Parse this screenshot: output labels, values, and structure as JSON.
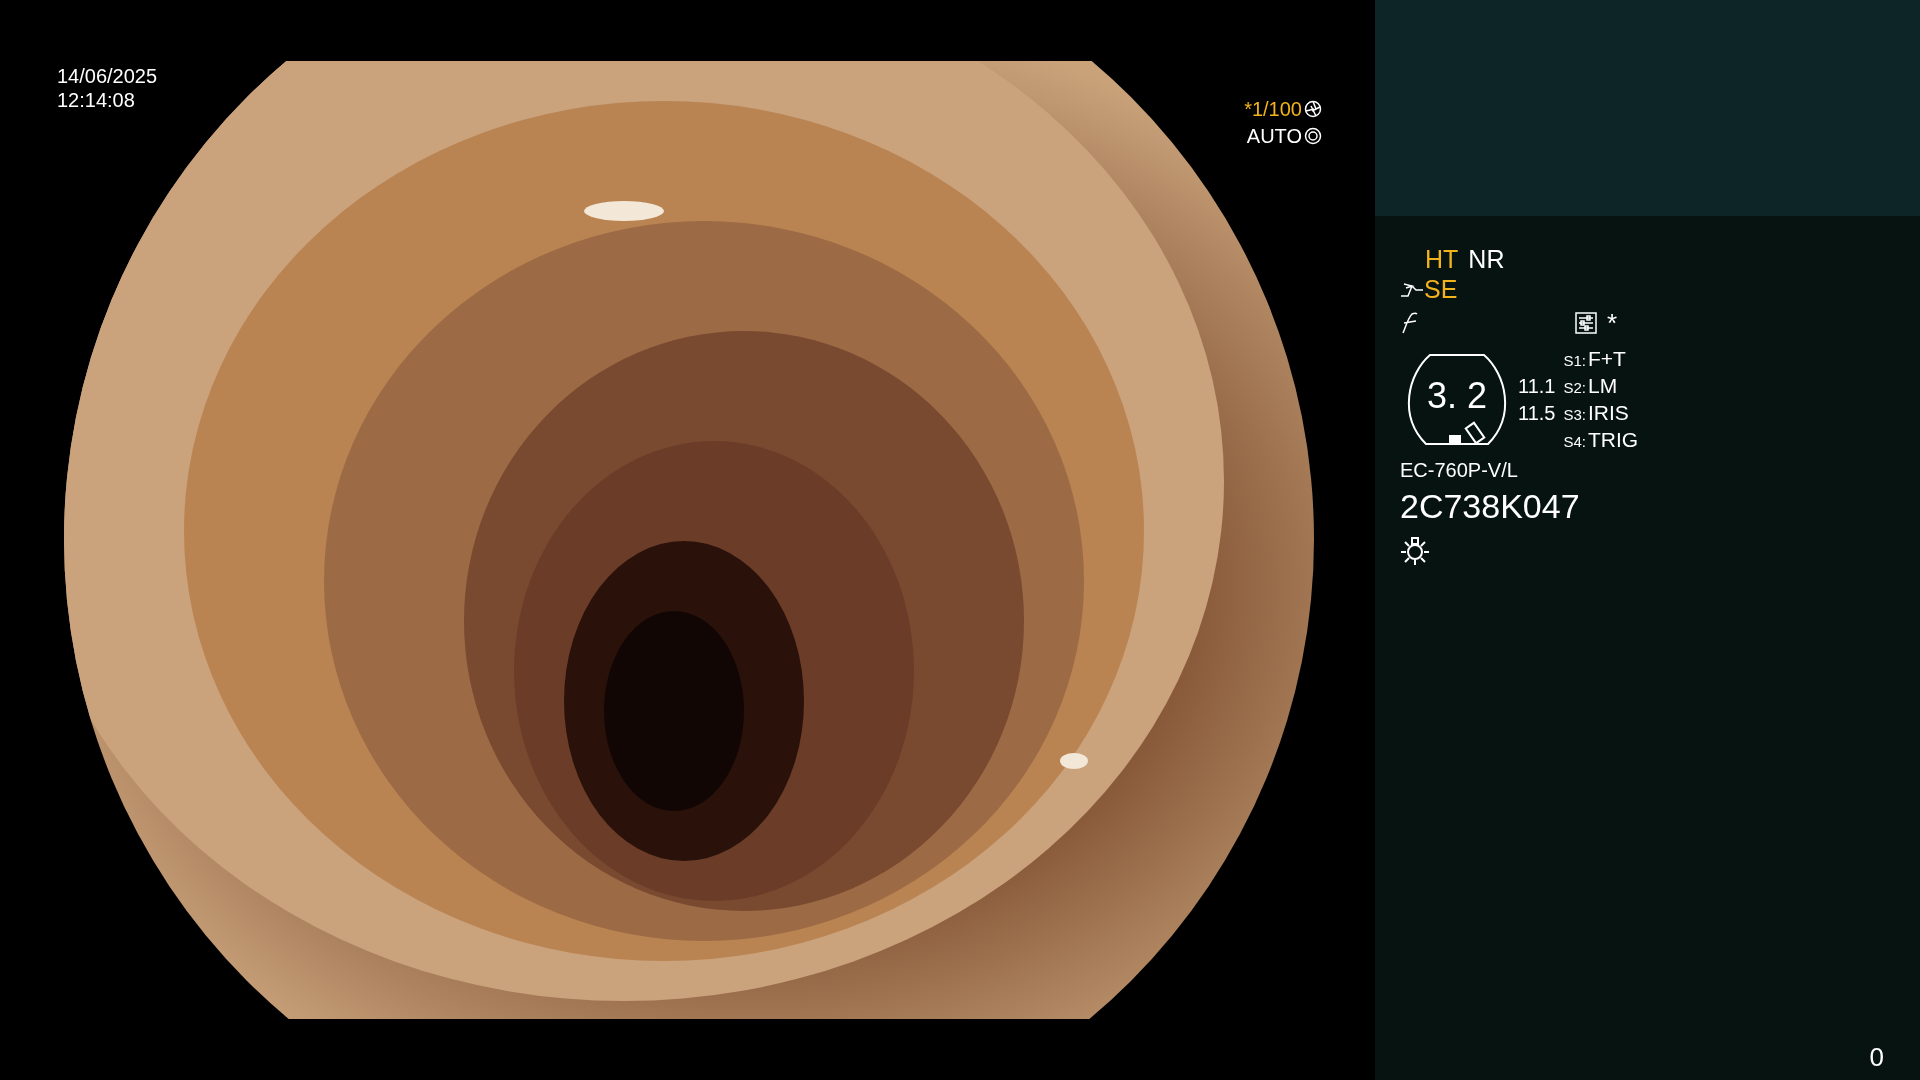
{
  "video": {
    "date": "14/06/2025",
    "time": "12:14:08",
    "shutter": {
      "label": "*1/100",
      "highlighted": true
    },
    "iris": {
      "label": "AUTO",
      "highlighted": false
    }
  },
  "panel": {
    "modes": [
      {
        "label": "HT",
        "on": true
      },
      {
        "label": "NR",
        "on": false
      }
    ],
    "enhance": {
      "label": "SE",
      "on": true
    },
    "asterisk": "*",
    "zoom": {
      "value": "3. 2",
      "near": "11.1",
      "far": "11.5"
    },
    "switches": [
      {
        "key": "S1:",
        "value": "F+T"
      },
      {
        "key": "S2:",
        "value": "LM"
      },
      {
        "key": "S3:",
        "value": "IRIS"
      },
      {
        "key": "S4:",
        "value": "TRIG"
      }
    ],
    "scope_model": "EC-760P-V/L",
    "serial": "2C738K047",
    "counter": "0"
  }
}
